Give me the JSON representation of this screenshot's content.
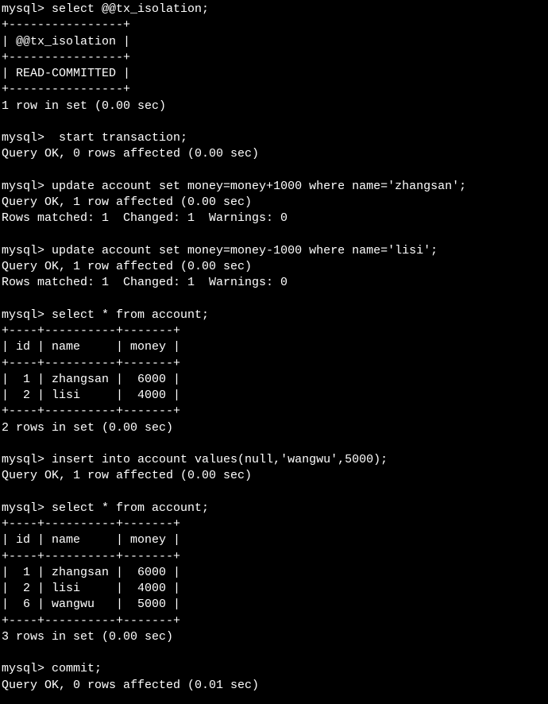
{
  "session": {
    "prompt": "mysql>",
    "commands": [
      {
        "cmd": " select @@tx_isolation;"
      },
      {
        "cmd": "  start transaction;"
      },
      {
        "cmd": " update account set money=money+1000 where name='zhangsan';"
      },
      {
        "cmd": " update account set money=money-1000 where name='lisi';"
      },
      {
        "cmd": " select * from account;"
      },
      {
        "cmd": " insert into account values(null,'wangwu',5000);"
      },
      {
        "cmd": " select * from account;"
      },
      {
        "cmd": " commit;"
      }
    ],
    "responses": {
      "query_ok_0": "Query OK, 0 rows affected (0.00 sec)",
      "query_ok_1": "Query OK, 1 row affected (0.00 sec)",
      "query_ok_commit": "Query OK, 0 rows affected (0.01 sec)",
      "rows_matched": "Rows matched: 1  Changed: 1  Warnings: 0",
      "one_row": "1 row in set (0.00 sec)",
      "two_rows": "2 rows in set (0.00 sec)",
      "three_rows": "3 rows in set (0.00 sec)"
    },
    "table1": {
      "border_top": "+----------------+",
      "header": "| @@tx_isolation |",
      "border_mid": "+----------------+",
      "row": "| READ-COMMITTED |",
      "border_bot": "+----------------+"
    },
    "table2": {
      "border": "+----+----------+-------+",
      "header": "| id | name     | money |",
      "row1": "|  1 | zhangsan |  6000 |",
      "row2": "|  2 | lisi     |  4000 |"
    },
    "table3": {
      "border": "+----+----------+-------+",
      "header": "| id | name     | money |",
      "row1": "|  1 | zhangsan |  6000 |",
      "row2": "|  2 | lisi     |  4000 |",
      "row3": "|  6 | wangwu   |  5000 |"
    }
  }
}
